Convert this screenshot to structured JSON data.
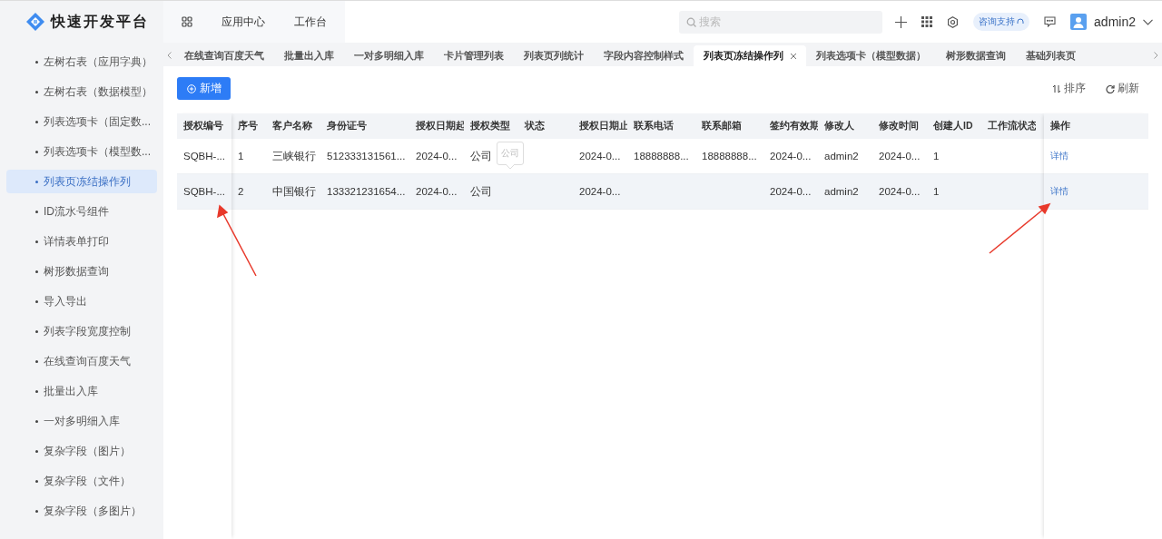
{
  "app": {
    "title": "快速开发平台"
  },
  "header": {
    "nav": [
      "应用中心",
      "工作台"
    ],
    "search": {
      "placeholder": "搜索"
    },
    "support_badge": "咨询支持",
    "user": "admin2"
  },
  "sidebar": {
    "items": [
      {
        "label": "左树右表（应用字典）",
        "selected": false
      },
      {
        "label": "左树右表（数据模型）",
        "selected": false
      },
      {
        "label": "列表选项卡（固定数...",
        "selected": false
      },
      {
        "label": "列表选项卡（模型数...",
        "selected": false
      },
      {
        "label": "列表页冻结操作列",
        "selected": true
      },
      {
        "label": "ID流水号组件",
        "selected": false
      },
      {
        "label": "详情表单打印",
        "selected": false
      },
      {
        "label": "树形数据查询",
        "selected": false
      },
      {
        "label": "导入导出",
        "selected": false
      },
      {
        "label": "列表字段宽度控制",
        "selected": false
      },
      {
        "label": "在线查询百度天气",
        "selected": false
      },
      {
        "label": "批量出入库",
        "selected": false
      },
      {
        "label": "一对多明细入库",
        "selected": false
      },
      {
        "label": "复杂字段（图片）",
        "selected": false
      },
      {
        "label": "复杂字段（文件）",
        "selected": false
      },
      {
        "label": "复杂字段（多图片）",
        "selected": false
      }
    ]
  },
  "tabs": [
    {
      "label": "在线查询百度天气",
      "selected": false
    },
    {
      "label": "批量出入库",
      "selected": false
    },
    {
      "label": "一对多明细入库",
      "selected": false
    },
    {
      "label": "卡片管理列表",
      "selected": false
    },
    {
      "label": "列表页列统计",
      "selected": false
    },
    {
      "label": "字段内容控制样式",
      "selected": false
    },
    {
      "label": "列表页冻结操作列",
      "selected": true
    },
    {
      "label": "列表选项卡（模型数据）",
      "selected": false
    },
    {
      "label": "树形数据查询",
      "selected": false
    },
    {
      "label": "基础列表页",
      "selected": false
    }
  ],
  "toolbar": {
    "add_button": "新增",
    "sort_button": "排序",
    "refresh_button": "刷新"
  },
  "table": {
    "tooltip": "公司",
    "columns": [
      {
        "label": "授权编号",
        "kind": "frozen"
      },
      {
        "label": "序号",
        "kind": "text"
      },
      {
        "label": "客户名称",
        "kind": "text"
      },
      {
        "label": "身份证号",
        "kind": "text"
      },
      {
        "label": "授权日期起",
        "kind": "text"
      },
      {
        "label": "授权类型",
        "kind": "text"
      },
      {
        "label": "状态",
        "kind": "text"
      },
      {
        "label": "授权日期止",
        "kind": "text"
      },
      {
        "label": "联系电话",
        "kind": "text"
      },
      {
        "label": "联系邮箱",
        "kind": "text"
      },
      {
        "label": "签约有效期",
        "kind": "text"
      },
      {
        "label": "修改人",
        "kind": "text"
      },
      {
        "label": "修改时间",
        "kind": "text"
      },
      {
        "label": "创建人ID",
        "kind": "text"
      },
      {
        "label": "工作流状态",
        "kind": "text"
      },
      {
        "label": "操作",
        "kind": "action"
      }
    ],
    "rows": [
      {
        "hovered": false,
        "cells": [
          "SQBH-...",
          "1",
          "三峡银行",
          "512333131561...",
          "2024-0...",
          "公司",
          "",
          "2024-0...",
          "18888888...",
          "18888888...",
          "2024-0...",
          "admin2",
          "2024-0...",
          "1",
          "",
          "详情"
        ]
      },
      {
        "hovered": true,
        "cells": [
          "SQBH-...",
          "2",
          "中国银行",
          "133321231654...",
          "2024-0...",
          "公司",
          "",
          "2024-0...",
          "",
          "",
          "2024-0...",
          "admin2",
          "2024-0...",
          "1",
          "",
          "详情"
        ]
      }
    ]
  }
}
